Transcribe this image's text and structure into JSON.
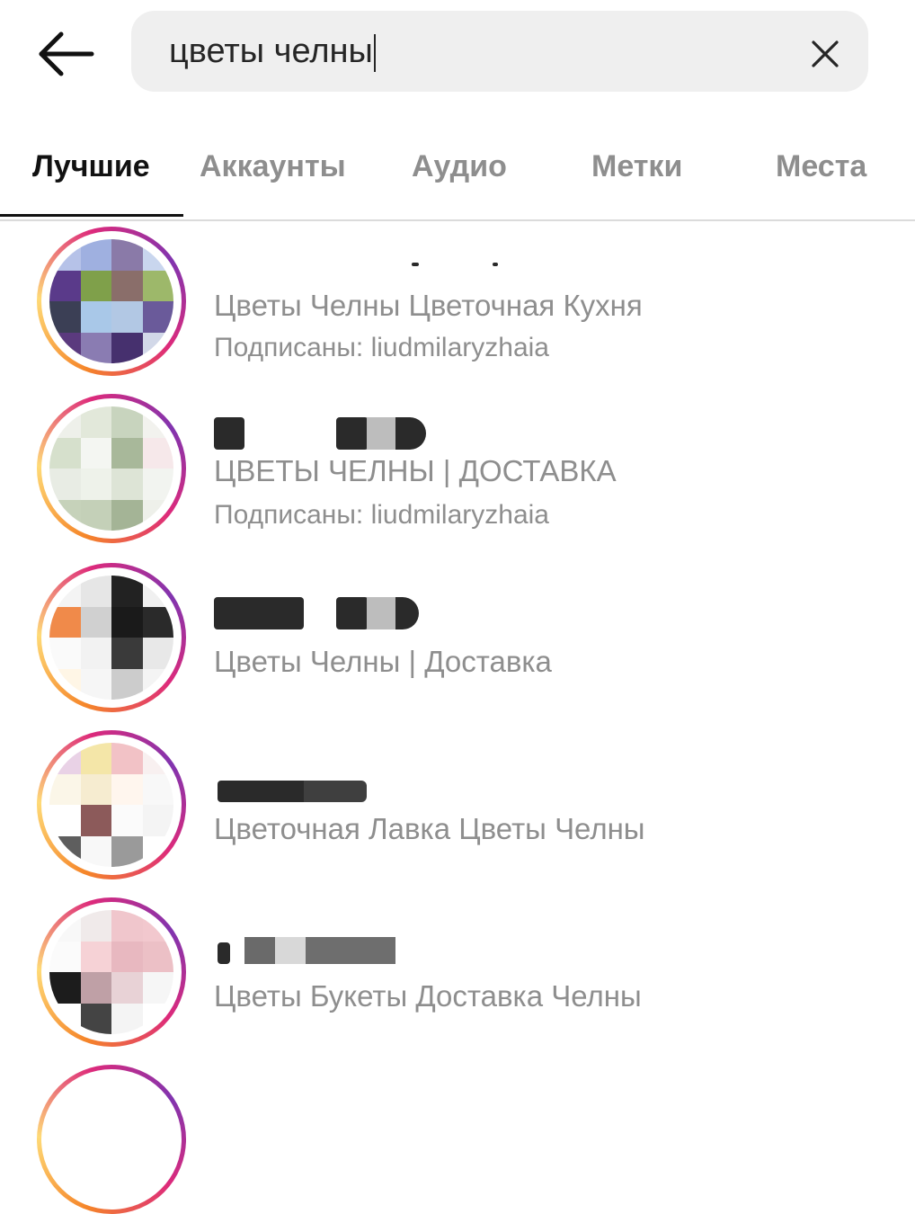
{
  "search": {
    "query": "цветы челны"
  },
  "tabs": [
    {
      "label": "Лучшие",
      "active": true
    },
    {
      "label": "Аккаунты",
      "active": false
    },
    {
      "label": "Аудио",
      "active": false
    },
    {
      "label": "Метки",
      "active": false
    },
    {
      "label": "Места",
      "active": false
    }
  ],
  "results": [
    {
      "full_name": "Цветы Челны Цветочная Кухня",
      "followed_by": "Подписаны: liudmilaryzhaia",
      "icon": "profile-avatar"
    },
    {
      "full_name": "ЦВЕТЫ ЧЕЛНЫ | ДОСТАВКА",
      "followed_by": "Подписаны: liudmilaryzhaia",
      "icon": "profile-avatar"
    },
    {
      "full_name": "Цветы Челны | Доставка",
      "icon": "profile-avatar"
    },
    {
      "full_name": "Цветочная Лавка Цветы Челны",
      "icon": "profile-avatar"
    },
    {
      "full_name": "Цветы  Букеты  Доставка  Челны",
      "icon": "profile-avatar"
    }
  ],
  "colors": {
    "text_primary": "#262626",
    "text_secondary": "#8e8e8e",
    "search_bg": "#efefef",
    "divider": "#dbdbdb",
    "story_ring": [
      "#f58529",
      "#feda77",
      "#dd2a7b",
      "#8134af"
    ]
  },
  "icons": {
    "back": "arrow-left-icon",
    "clear": "close-icon"
  }
}
